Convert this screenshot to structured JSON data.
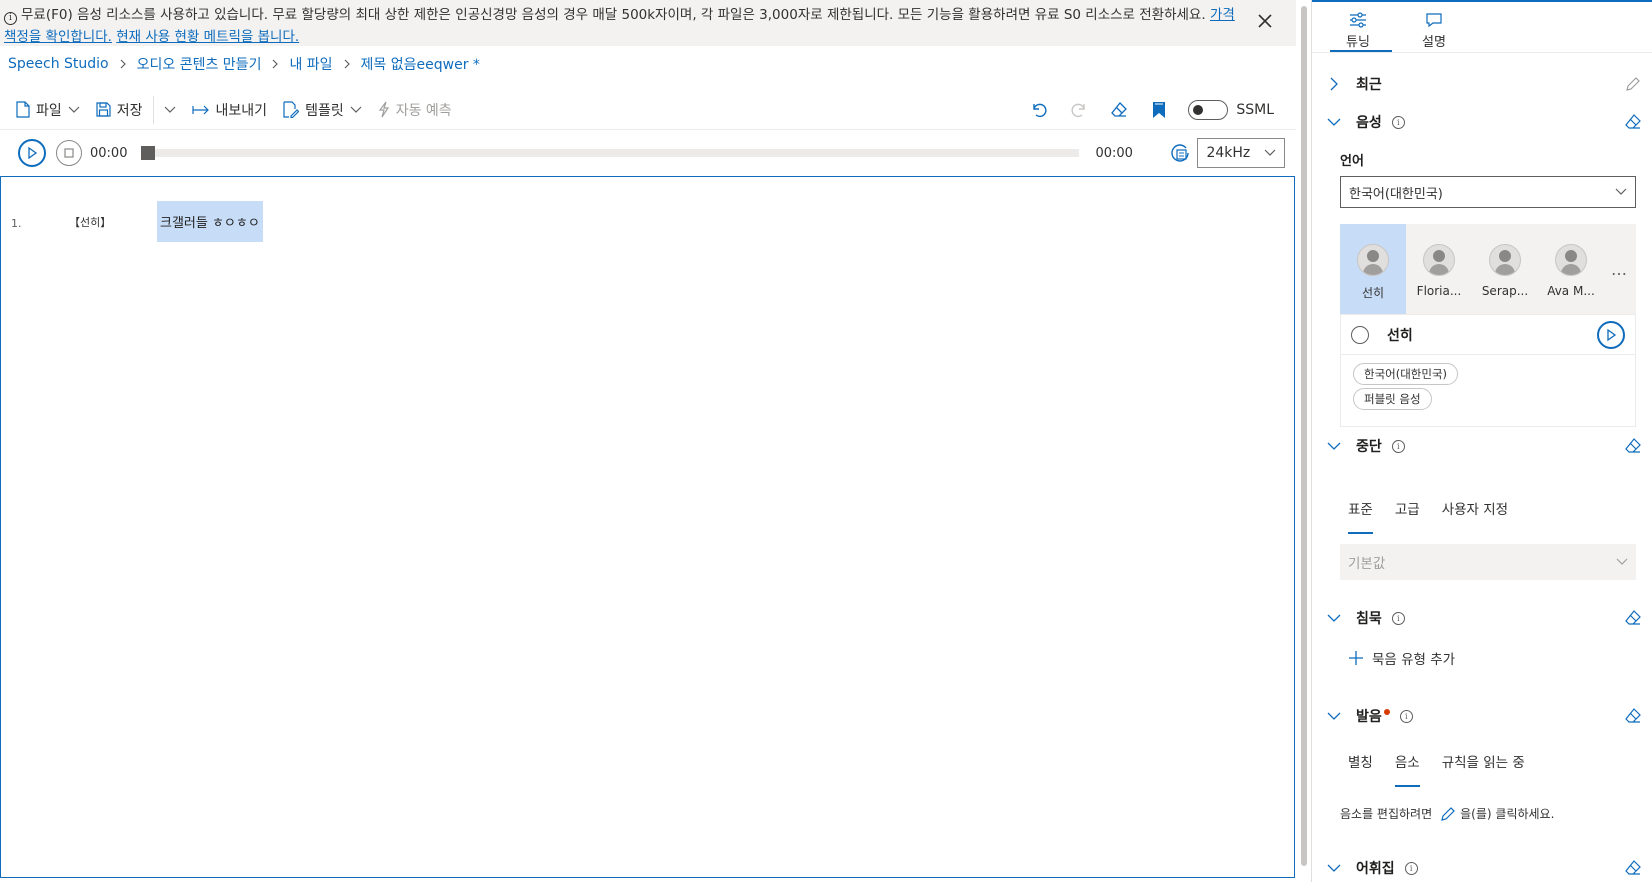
{
  "banner": {
    "text": "무료(F0) 음성 리소스를 사용하고 있습니다. 무료 할당량의 최대 상한 제한은 인공신경망 음성의 경우 매달 500k자이며, 각 파일은 3,000자로 제한됩니다. 모든 기능을 활용하려면 유료 S0 리소스로 전환하세요. ",
    "link_pricing": "가격 책정을 확인합니다.",
    "link_metrics": "현재 사용 현황 메트릭을 봅니다."
  },
  "breadcrumb": [
    "Speech Studio",
    "오디오 콘텐츠 만들기",
    "내 파일",
    "제목 없음eeqwer *"
  ],
  "toolbar": {
    "file": "파일",
    "save": "저장",
    "export": "내보내기",
    "template": "템플릿",
    "auto_predict": "자동 예측",
    "ssml": "SSML"
  },
  "player": {
    "time_start": "00:00",
    "time_end": "00:00",
    "sample_rate": "24kHz",
    "progress": 0
  },
  "editor": {
    "lines": [
      {
        "number": "1.",
        "speaker": "【선히】",
        "text": "크갤러들 ㅎㅇㅎㅇ"
      }
    ]
  },
  "panel": {
    "tabs": [
      "튜닝",
      "설명"
    ],
    "sections": {
      "recent": "최근",
      "voice": "음성",
      "break": "중단",
      "silence": "침묵",
      "pronunciation": "발음",
      "lexicon": "어휘집"
    },
    "language_label": "언어",
    "language_value": "한국어(대한민국)",
    "voices": [
      "선히",
      "Floria...",
      "Serap...",
      "Ava M..."
    ],
    "more": "…",
    "voice_card": {
      "name": "선히",
      "chips": [
        "한국어(대한민국)",
        "퍼블릿 음성"
      ]
    },
    "break_tabs": [
      "표준",
      "고급",
      "사용자 지정"
    ],
    "break_default": "기본값",
    "add_silence": "묵음 유형 추가",
    "pron_tabs": [
      "별칭",
      "음소",
      "규칙을 읽는 중"
    ],
    "pron_hint_pre": "음소를 편집하려면",
    "pron_hint_post": "을(를) 클릭하세요."
  }
}
